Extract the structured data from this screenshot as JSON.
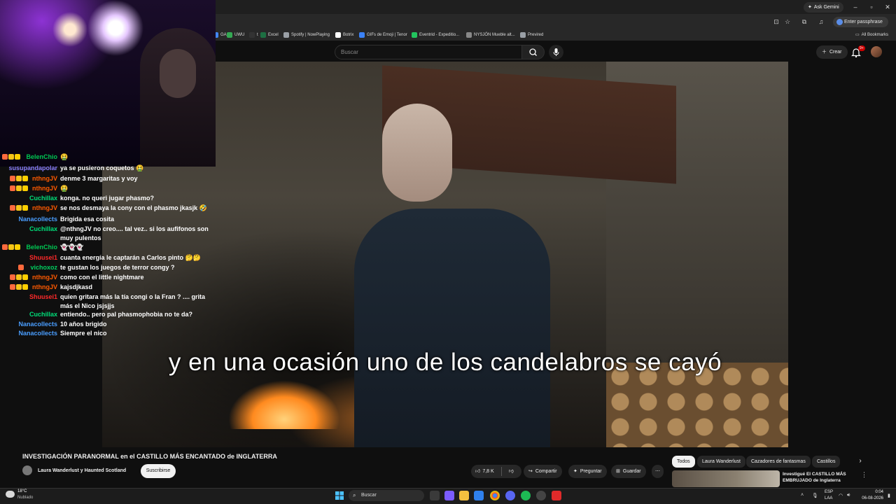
{
  "browser": {
    "ask_gemini": "Ask Gemini",
    "enter_passphrase": "Enter passphrase",
    "all_bookmarks": "All Bookmarks",
    "bookmarks": [
      {
        "label": "GA",
        "color": "#4285f4"
      },
      {
        "label": "UWU",
        "color": "#34a853"
      },
      {
        "label": "t",
        "color": "#333333"
      },
      {
        "label": "Excel",
        "color": "#1d6f42"
      },
      {
        "label": "Spotify | NowPlaying",
        "color": "#9aa0a6"
      },
      {
        "label": "Botrix",
        "color": "#ffffff"
      },
      {
        "label": "GIFs de Emoji | Tenor",
        "color": "#3b82f6"
      },
      {
        "label": "Eventrid - Expeditio...",
        "color": "#22c55e"
      },
      {
        "label": "NYSJÖN Mueble alt...",
        "color": "#888888"
      },
      {
        "label": "Previred",
        "color": "#9aa0a6"
      }
    ]
  },
  "youtube": {
    "search_placeholder": "Buscar",
    "create_label": "Crear",
    "notif_count": "9+"
  },
  "video": {
    "subtitle": "y en una ocasión uno de los candelabros se cayó",
    "title": "INVESTIGACIÓN PARANORMAL en el CASTILLO MÁS ENCANTADO de INGLATERRA",
    "channel": "Laura Wanderlust y Haunted Scotland",
    "subscribe_label": "Suscribirse",
    "likes": "7,8 K",
    "share_label": "Compartir",
    "ask_label": "Preguntar",
    "save_label": "Guardar"
  },
  "chips": [
    "Todos",
    "Laura Wanderlust",
    "Cazadores de fantasmas",
    "Castillos"
  ],
  "recommended": {
    "title": "Investigué El CASTILLO MÁS EMBRUJADO de Inglaterra"
  },
  "chat": [
    {
      "user": "BelenChio",
      "color": "#00c853",
      "msg": "🤮",
      "badges": 3
    },
    {
      "user": "susupandapolar",
      "color": "#8a7dff",
      "msg": "ya se pusieron coquetos 🤮",
      "badges": 0
    },
    {
      "user": "nthngJV",
      "color": "#ff5a00",
      "msg": "denme 3 margaritas y voy",
      "badges": 3
    },
    {
      "user": "nthngJV",
      "color": "#ff5a00",
      "msg": "🤮",
      "badges": 3
    },
    {
      "user": "Cuchillax",
      "color": "#00e07a",
      "msg": "konga. no queri jugar phasmo?",
      "badges": 0
    },
    {
      "user": "nthngJV",
      "color": "#ff5a00",
      "msg": "se nos desmaya la cony con el phasmo jkasjk 🤣",
      "badges": 3
    },
    {
      "user": "Nanacollects",
      "color": "#4a9eff",
      "msg": "Brigida esa cosita",
      "badges": 0
    },
    {
      "user": "Cuchillax",
      "color": "#00e07a",
      "msg": "@nthngJV no creo.... tal vez.. si los aufifonos son muy pulentos",
      "badges": 0
    },
    {
      "user": "BelenChio",
      "color": "#00c853",
      "msg": "👻👻👻",
      "badges": 3
    },
    {
      "user": "Shuusei1",
      "color": "#ff2a2a",
      "msg": "cuanta energía le captarán a Carlos pinto 🤔🤔",
      "badges": 0
    },
    {
      "user": "vichoxoz",
      "color": "#00d060",
      "msg": "te gustan los juegos de terror congy ?",
      "badges": 1
    },
    {
      "user": "nthngJV",
      "color": "#ff5a00",
      "msg": "como con el little nightmare",
      "badges": 3
    },
    {
      "user": "nthngJV",
      "color": "#ff5a00",
      "msg": "kajsdjkasd",
      "badges": 3
    },
    {
      "user": "Shuusei1",
      "color": "#ff2a2a",
      "msg": "quien gritara más la tía congi o la Fran ? .... grita más el Nico jsjsjjs",
      "badges": 0
    },
    {
      "user": "Cuchillax",
      "color": "#00e07a",
      "msg": "entiendo.. pero pal phasmophobia no te da?",
      "badges": 0
    },
    {
      "user": "Nanacollects",
      "color": "#4a9eff",
      "msg": "10 años brigido",
      "badges": 0
    },
    {
      "user": "Nanacollects",
      "color": "#4a9eff",
      "msg": "Siempre el nico",
      "badges": 0
    }
  ],
  "taskbar": {
    "temp": "18°C",
    "weather": "Nublado",
    "search": "Buscar",
    "lang1": "ESP",
    "lang2": "LAA",
    "time": "0:04",
    "date": "06-08-2026"
  }
}
